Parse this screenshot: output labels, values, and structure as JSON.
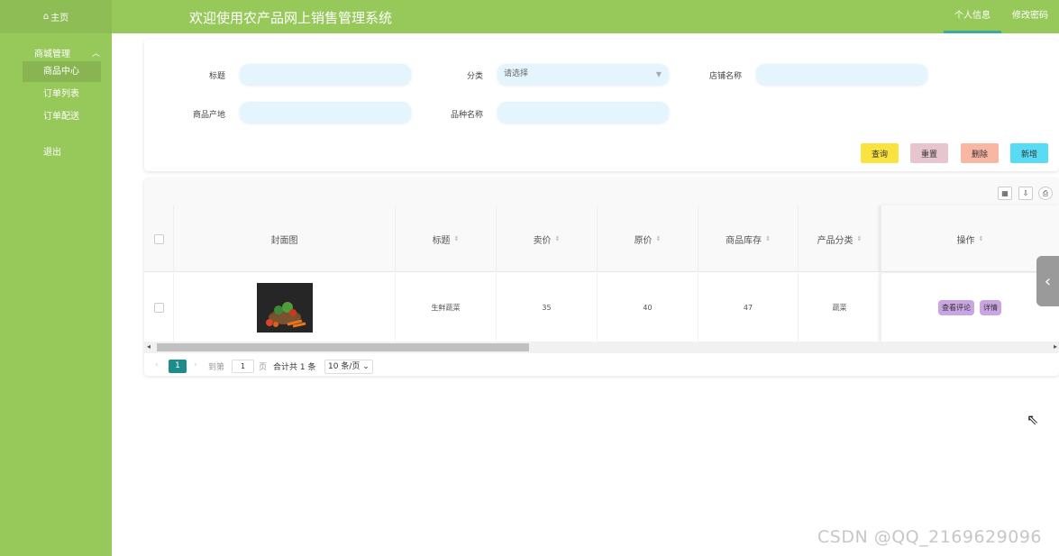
{
  "header": {
    "home_label": "主页",
    "home_icon": "home-icon",
    "app_title": "欢迎使用农产品网上销售管理系统",
    "links": [
      "个人信息",
      "修改密码"
    ]
  },
  "sidebar": {
    "group_label": "商城管理",
    "items": [
      {
        "label": "商品中心",
        "active": true
      },
      {
        "label": "订单列表",
        "active": false
      },
      {
        "label": "订单配送",
        "active": false
      },
      {
        "label": "退出",
        "active": false
      }
    ]
  },
  "search": {
    "title_label": "标题",
    "category_label": "分类",
    "category_placeholder": "请选择",
    "shop_label": "店铺名称",
    "origin_label": "商品产地",
    "variety_label": "品种名称",
    "buttons": {
      "query": "查询",
      "reset": "重置",
      "delete": "删除",
      "add": "新增"
    },
    "button_colors": {
      "query": "#fbe33f",
      "reset": "#e7c5cf",
      "delete": "#f8b7a3",
      "add": "#58dcf5"
    }
  },
  "table": {
    "columns": [
      "封面图",
      "标题",
      "卖价",
      "原价",
      "商品库存",
      "产品分类",
      "操作"
    ],
    "rows": [
      {
        "title": "生鲜蔬菜",
        "price": "35",
        "original_price": "40",
        "stock": "47",
        "category": "蔬菜",
        "actions": [
          "查看评论",
          "详情"
        ]
      }
    ],
    "action_colors": {
      "review": "#c9a5e3",
      "detail": "#c9a5e3"
    }
  },
  "pagination": {
    "current_page": "1",
    "goto_prefix": "到第",
    "goto_value": "1",
    "goto_suffix": "页",
    "total": "合计共 1 条",
    "page_size": "10 条/页"
  },
  "watermark": "CSDN @QQ_2169629096",
  "colors": {
    "accent_green": "#97c85a",
    "active_tab_underline": "#3fa9a0",
    "pager_active": "#1f8c8c"
  }
}
